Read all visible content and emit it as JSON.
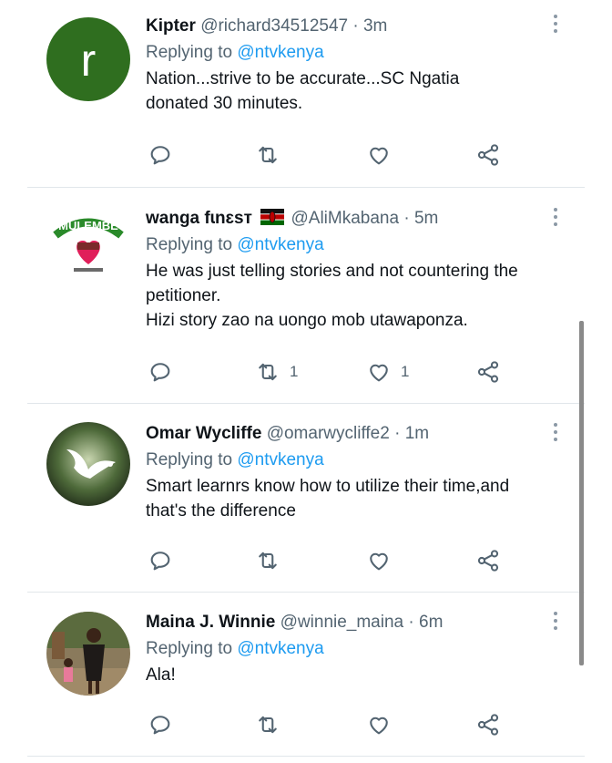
{
  "tweets": [
    {
      "name": "Kipter",
      "handle": "@richard34512547",
      "dot": "·",
      "time": "3m",
      "replying_prefix": "Replying to",
      "replying_to": "@ntvkenya",
      "text": "Nation...strive to be accurate...SC Ngatia\ndonated 30 minutes.",
      "avatar_letter": "r",
      "avatar_color": "#2f6e1f",
      "retweets": "",
      "likes": ""
    },
    {
      "name": "wanga fɩnɛsт",
      "handle": "@AliMkabana",
      "dot": "·",
      "time": "5m",
      "replying_prefix": "Replying to",
      "replying_to": "@ntvkenya",
      "text": "He was just telling stories and not countering the\npetitioner.\nHizi story zao na uongo mob utawaponza.",
      "avatar_logo_text": "MULEMBE",
      "retweets": "1",
      "likes": "1"
    },
    {
      "name": "Omar Wycliffe",
      "handle": "@omarwycliffe2",
      "dot": "·",
      "time": "1m",
      "replying_prefix": "Replying to",
      "replying_to": "@ntvkenya",
      "text": "Smart learnrs know how to utilize their time,and\nthat's the difference",
      "retweets": "",
      "likes": ""
    },
    {
      "name": "Maina J. Winnie",
      "handle": "@winnie_maina",
      "dot": "·",
      "time": "6m",
      "replying_prefix": "Replying to",
      "replying_to": "@ntvkenya",
      "text": "Ala!",
      "retweets": "",
      "likes": ""
    }
  ],
  "icons": {
    "reply": "reply-icon",
    "retweet": "retweet-icon",
    "like": "like-icon",
    "share": "share-icon",
    "more": "more-options-icon"
  },
  "colors": {
    "text": "#0f1419",
    "secondary": "#536471",
    "link": "#1d9bf0",
    "divider": "#e1e6ea"
  }
}
